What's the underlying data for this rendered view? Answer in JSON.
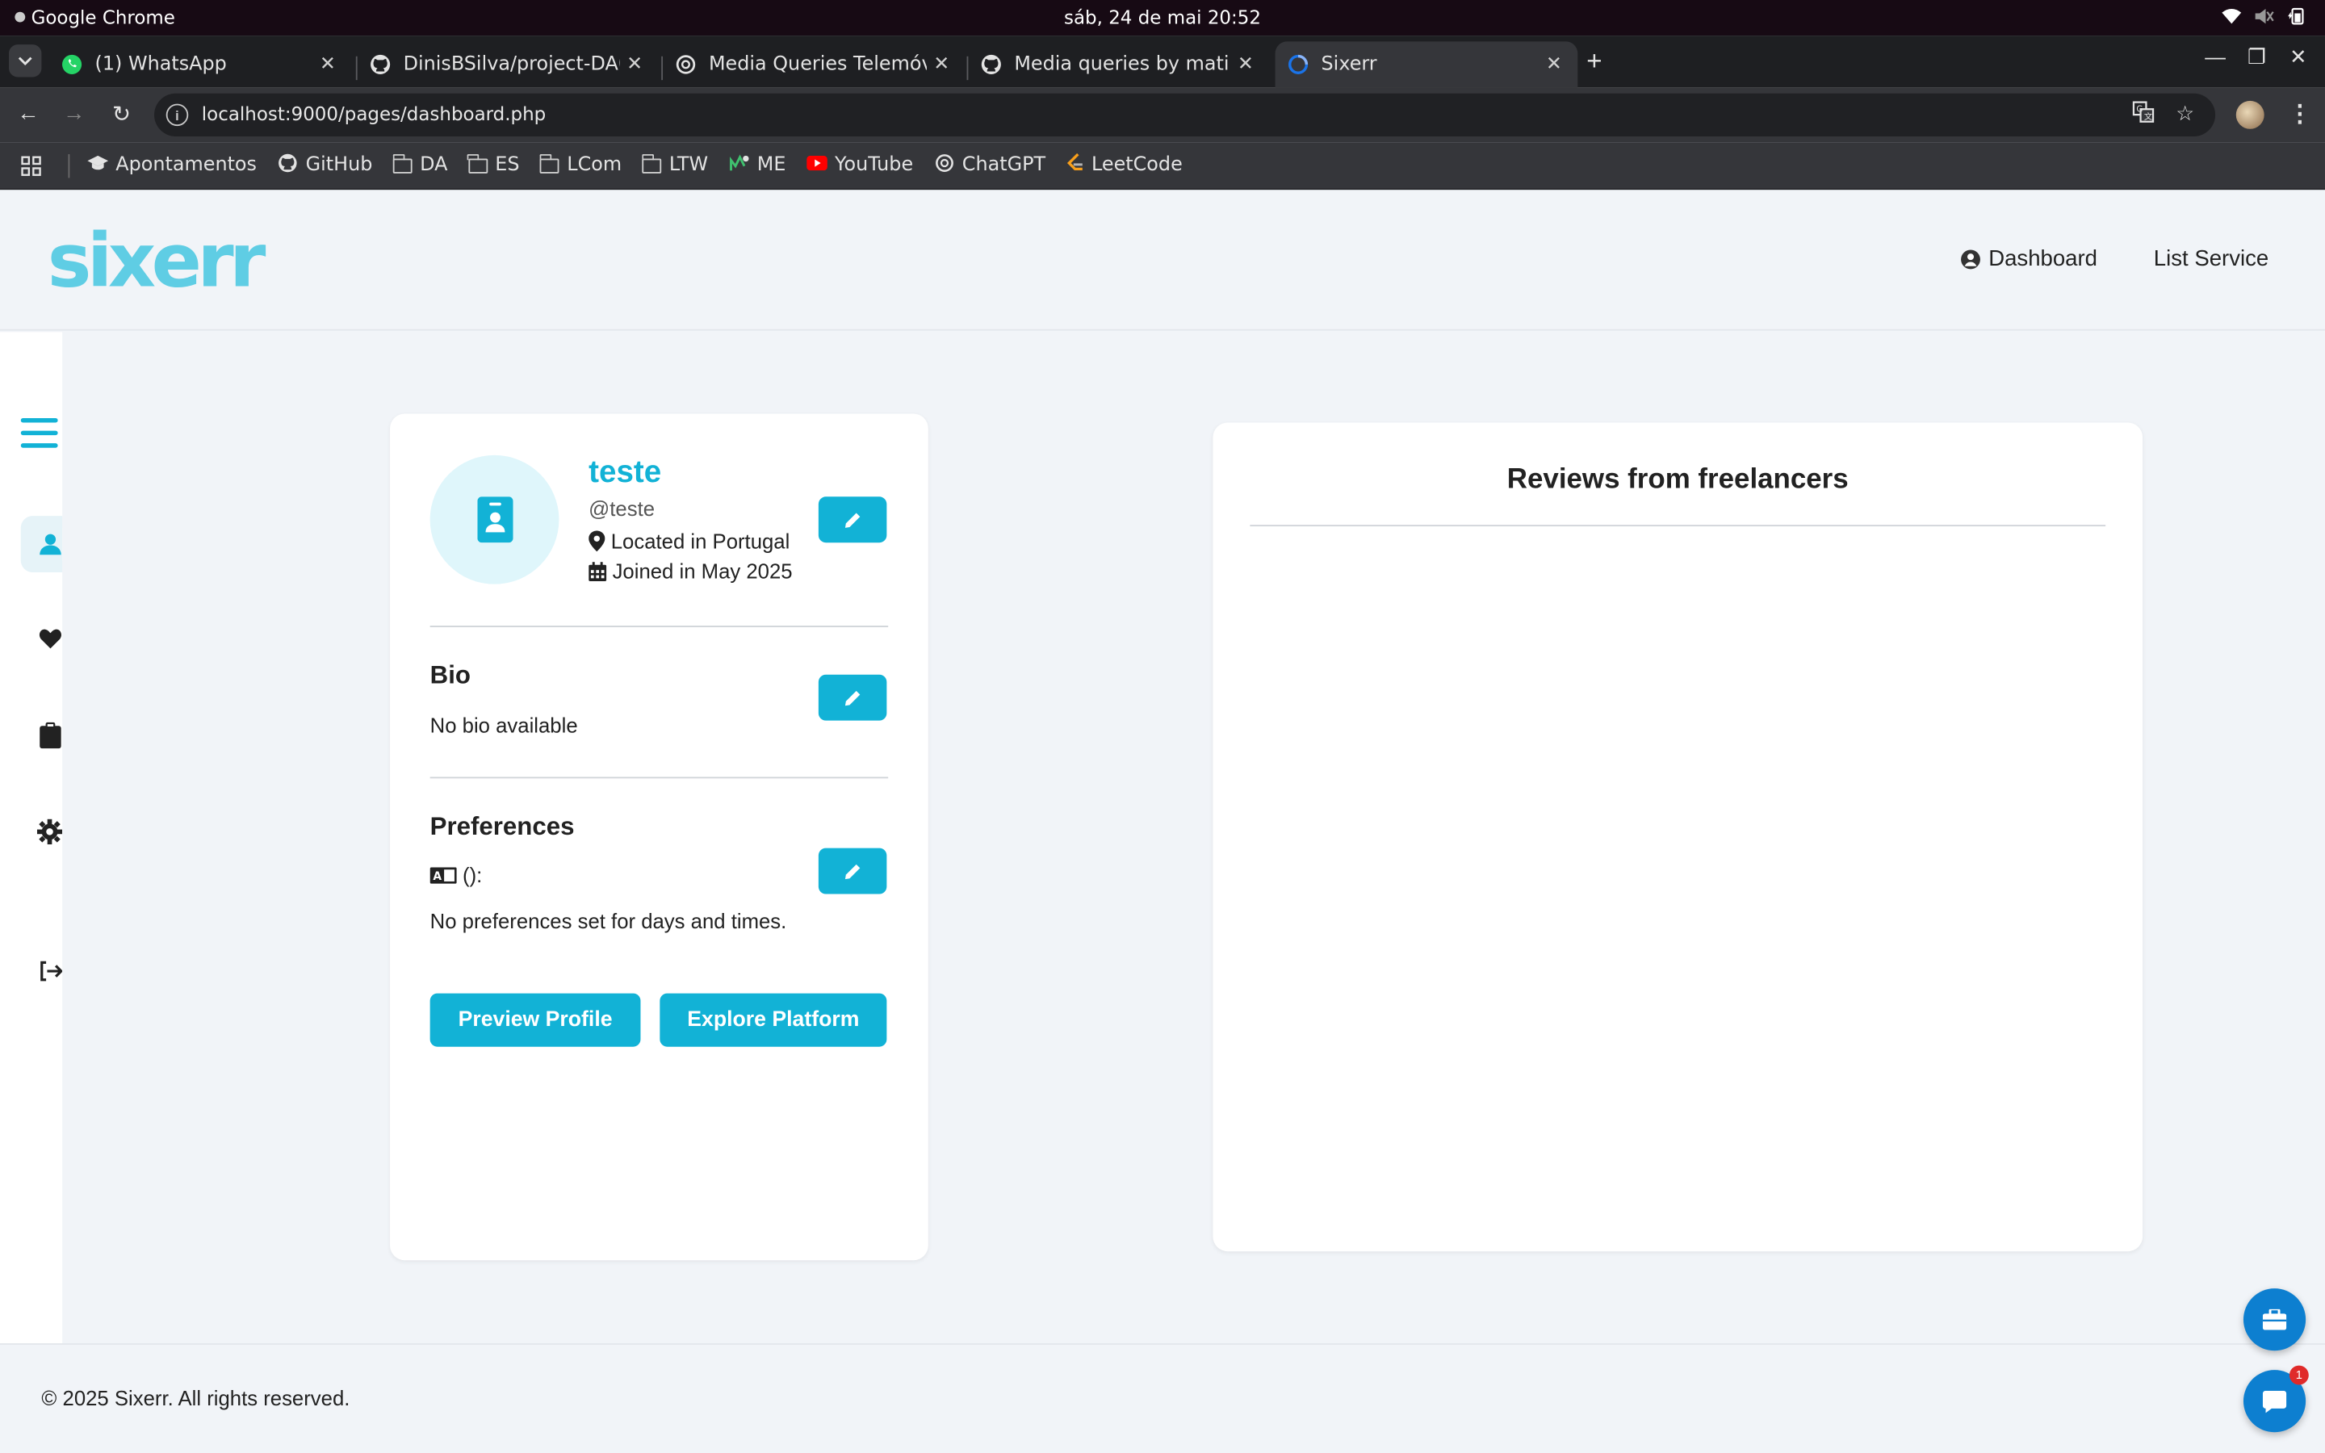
{
  "os": {
    "app_name": "Google Chrome",
    "clock": "sáb, 24 de mai  20:52"
  },
  "browser": {
    "tabs": [
      {
        "title": "(1) WhatsApp",
        "icon": "whatsapp-icon"
      },
      {
        "title": "DinisBSilva/project-DA02",
        "icon": "github-icon"
      },
      {
        "title": "Media Queries Telemóvel",
        "icon": "chatgpt-icon"
      },
      {
        "title": "Media queries by matilde",
        "icon": "github-icon"
      },
      {
        "title": "Sixerr",
        "icon": "loading-icon",
        "active": true
      }
    ],
    "url": "localhost:9000/pages/dashboard.php",
    "bookmarks": [
      {
        "label": "Apontamentos",
        "icon": "graduation-cap-icon"
      },
      {
        "label": "GitHub",
        "icon": "github-icon"
      },
      {
        "label": "DA",
        "icon": "folder-icon"
      },
      {
        "label": "ES",
        "icon": "folder-icon"
      },
      {
        "label": "LCom",
        "icon": "folder-icon"
      },
      {
        "label": "LTW",
        "icon": "folder-icon"
      },
      {
        "label": "ME",
        "icon": "me-icon"
      },
      {
        "label": "YouTube",
        "icon": "youtube-icon"
      },
      {
        "label": "ChatGPT",
        "icon": "chatgpt-icon"
      },
      {
        "label": "LeetCode",
        "icon": "leetcode-icon"
      }
    ]
  },
  "site": {
    "logo_text": "sixerr",
    "nav": {
      "dashboard": "Dashboard",
      "list_service": "List Service"
    }
  },
  "profile": {
    "name": "teste",
    "handle": "@teste",
    "location": "Located in Portugal",
    "joined": "Joined in May 2025",
    "bio_title": "Bio",
    "bio_text": "No bio available",
    "prefs_title": "Preferences",
    "prefs_lang": "():",
    "prefs_text": "No preferences set for days and times.",
    "preview_label": "Preview Profile",
    "explore_label": "Explore Platform"
  },
  "reviews": {
    "title": "Reviews from freelancers"
  },
  "footer": {
    "text": "© 2025 Sixerr. All rights reserved."
  },
  "fab": {
    "chat_badge": "1"
  },
  "colors": {
    "accent": "#12b2d6",
    "fab": "#0d7fd0",
    "page_bg": "#f1f4f8"
  }
}
